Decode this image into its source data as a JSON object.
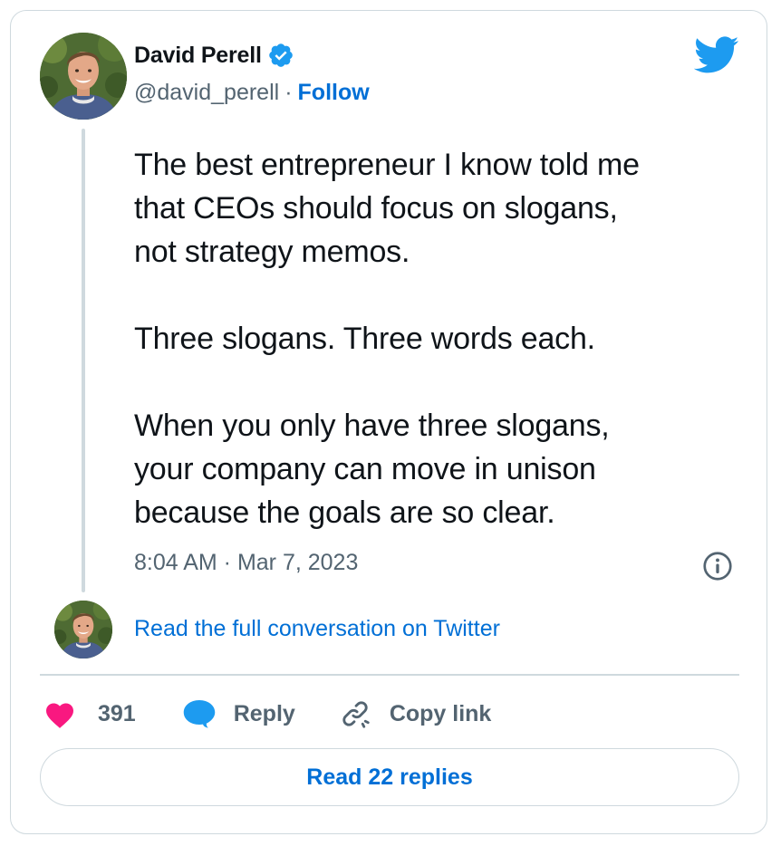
{
  "author": {
    "display_name": "David Perell",
    "handle": "@david_perell",
    "separator": "·",
    "follow_label": "Follow",
    "verified": true
  },
  "tweet": {
    "text": "The best entrepreneur I know told me\nthat CEOs should focus on slogans,\nnot strategy memos.\n\nThree slogans. Three words each.\n\nWhen you only have three slogans,\nyour company can move in unison\nbecause the goals are so clear.",
    "timestamp": "8:04 AM · Mar 7, 2023"
  },
  "conversation": {
    "read_full_label": "Read the full conversation on Twitter"
  },
  "actions": {
    "like_count": "391",
    "reply_label": "Reply",
    "copy_link_label": "Copy link"
  },
  "replies_button_label": "Read 22 replies",
  "icons": {
    "brand": "twitter-bird-icon",
    "verified": "verified-badge-icon",
    "info": "info-icon",
    "like": "heart-icon",
    "reply": "speech-bubble-icon",
    "copy": "link-icon"
  },
  "colors": {
    "link_blue": "#006fd6",
    "twitter_blue": "#1d9bf0",
    "heart_pink": "#f91880",
    "muted_gray": "#536471",
    "border": "#cfd9de",
    "text": "#0f1419"
  }
}
